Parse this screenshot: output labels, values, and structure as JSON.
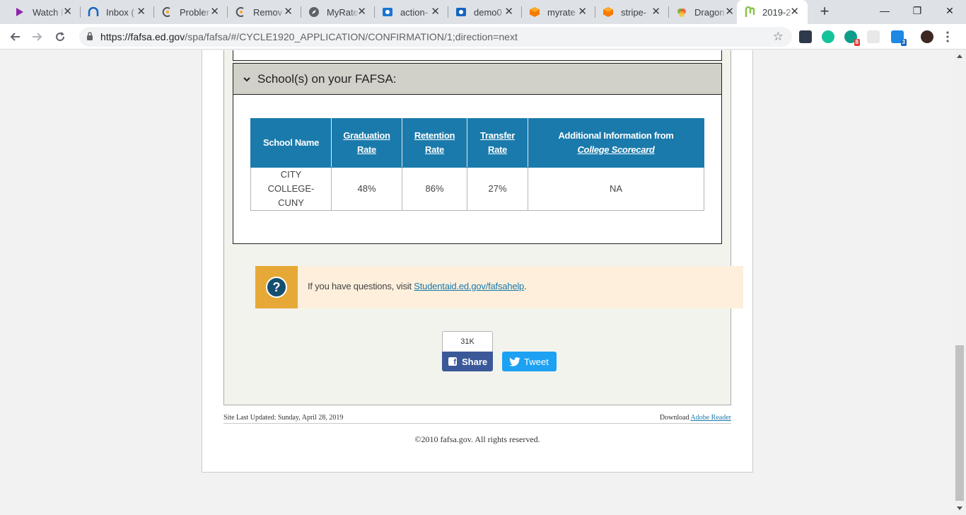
{
  "browser": {
    "tabs": [
      {
        "title": "Watch I",
        "icon": "play-icon",
        "color": "#8e24aa"
      },
      {
        "title": "Inbox (",
        "icon": "inbox-icon",
        "color": "#1565c0"
      },
      {
        "title": "Probler",
        "icon": "problem-icon",
        "color": "#555555"
      },
      {
        "title": "Remov",
        "icon": "remove-icon",
        "color": "#555555"
      },
      {
        "title": "MyRate",
        "icon": "compass-icon",
        "color": "#5c6bc0"
      },
      {
        "title": "action-",
        "icon": "action-icon",
        "color": "#1976d2"
      },
      {
        "title": "demo0",
        "icon": "demo-icon",
        "color": "#1565c0"
      },
      {
        "title": "myrate",
        "icon": "box-icon",
        "color": "#f57c00"
      },
      {
        "title": "stripe-",
        "icon": "box-icon",
        "color": "#f57c00"
      },
      {
        "title": "Dragon",
        "icon": "dragon-icon",
        "color": "#7cb342"
      },
      {
        "title": "2019-2",
        "icon": "fafsa-icon",
        "color": "#8bc34a",
        "active": true
      }
    ],
    "url_host": "https://fafsa.ed.gov",
    "url_path": "/spa/fafsa/#/CYCLE1920_APPLICATION/CONFIRMATION/1;direction=next",
    "extension_badges": {
      "badge_a": "8",
      "badge_s": "3"
    }
  },
  "section": {
    "title": "School(s) on your FAFSA:"
  },
  "schools_table": {
    "headers": {
      "school_name": "School Name",
      "graduation_rate": "Graduation Rate",
      "retention_rate": "Retention Rate",
      "transfer_rate": "Transfer Rate",
      "additional_info_prefix": "Additional Information from",
      "additional_info_link": "College Scorecard"
    },
    "rows": [
      {
        "school_name": "CITY COLLEGE-CUNY",
        "graduation_rate": "48%",
        "retention_rate": "86%",
        "transfer_rate": "27%",
        "additional_info": "NA"
      }
    ]
  },
  "help": {
    "icon": "question-icon",
    "text": "If you have questions, visit ",
    "link": "Studentaid.ed.gov/fafsahelp",
    "suffix": "."
  },
  "social": {
    "share_count": "31K",
    "share_label": "Share",
    "tweet_label": "Tweet"
  },
  "footer": {
    "updated": "Site Last Updated: Sunday, April 28, 2019",
    "download_prefix": "Download ",
    "download_link": "Adobe Reader",
    "copyright": "©2010 fafsa.gov. All rights reserved."
  }
}
